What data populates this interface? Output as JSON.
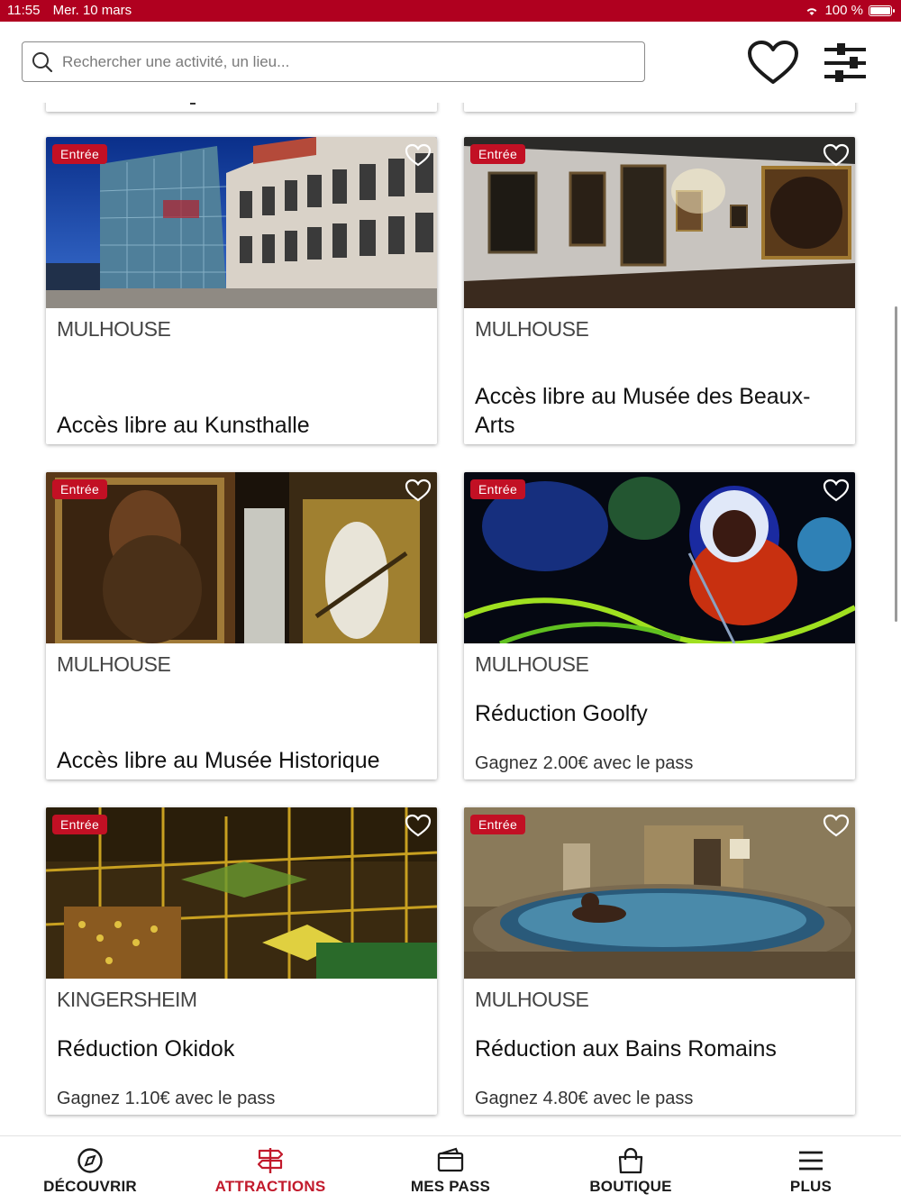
{
  "status_bar": {
    "time": "11:55",
    "date": "Mer. 10 mars",
    "battery": "100 %"
  },
  "search": {
    "placeholder": "Rechercher une activité, un lieu..."
  },
  "colors": {
    "brand": "#b0001f",
    "badge": "#c21024",
    "active_tab": "#c21a2c"
  },
  "icons": {
    "favorites": "heart-icon",
    "filters": "sliders-icon"
  },
  "cards": [
    {
      "badge": "Entrée",
      "city": "MULHOUSE",
      "title": "Accès libre au Kunsthalle",
      "subtitle": ""
    },
    {
      "badge": "Entrée",
      "city": "MULHOUSE",
      "title": "Accès libre au Musée des Beaux-Arts",
      "subtitle": ""
    },
    {
      "badge": "Entrée",
      "city": "MULHOUSE",
      "title": "Accès libre au Musée Historique",
      "subtitle": ""
    },
    {
      "badge": "Entrée",
      "city": "MULHOUSE",
      "title": "Réduction Goolfy",
      "subtitle": "Gagnez 2.00€ avec le pass"
    },
    {
      "badge": "Entrée",
      "city": "KINGERSHEIM",
      "title": "Réduction Okidok",
      "subtitle": "Gagnez 1.10€ avec le pass"
    },
    {
      "badge": "Entrée",
      "city": "MULHOUSE",
      "title": "Réduction aux Bains Romains",
      "subtitle": "Gagnez 4.80€ avec le pass"
    }
  ],
  "tabs": [
    {
      "label": "DÉCOUVRIR",
      "icon": "compass-icon",
      "active": false
    },
    {
      "label": "ATTRACTIONS",
      "icon": "signpost-icon",
      "active": true
    },
    {
      "label": "MES PASS",
      "icon": "wallet-icon",
      "active": false
    },
    {
      "label": "BOUTIQUE",
      "icon": "shopping-bag-icon",
      "active": false
    },
    {
      "label": "PLUS",
      "icon": "menu-icon",
      "active": false
    }
  ]
}
